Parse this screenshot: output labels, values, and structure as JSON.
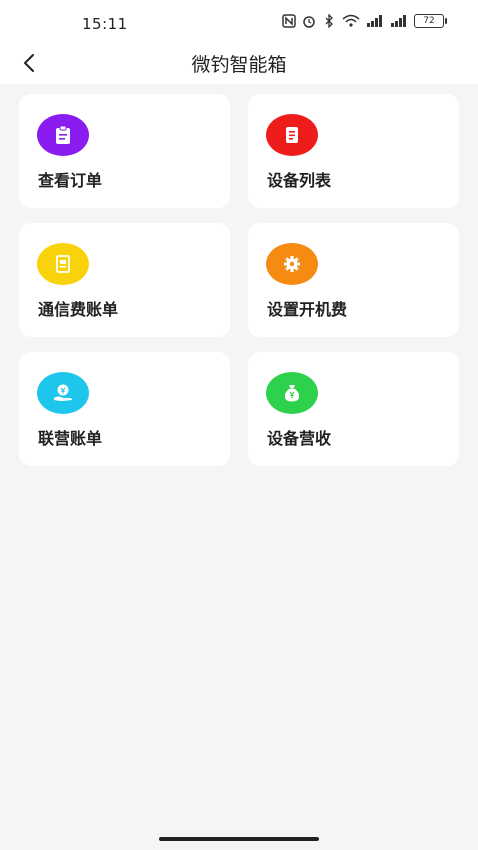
{
  "status_bar": {
    "time": "15:11",
    "battery": "72"
  },
  "nav": {
    "title": "微钓智能箱",
    "back_icon": "chevron-left-icon"
  },
  "menu": {
    "items": [
      {
        "label": "查看订单",
        "icon": "clipboard-icon",
        "color": "#8a1cf0"
      },
      {
        "label": "设备列表",
        "icon": "document-icon",
        "color": "#ef1c1c"
      },
      {
        "label": "通信费账单",
        "icon": "bill-icon",
        "color": "#f8d30c"
      },
      {
        "label": "设置开机费",
        "icon": "gear-icon",
        "color": "#f58b12"
      },
      {
        "label": "联营账单",
        "icon": "coin-hand-icon",
        "color": "#1dc6ea"
      },
      {
        "label": "设备营收",
        "icon": "money-bag-icon",
        "color": "#2ed14c"
      }
    ]
  }
}
